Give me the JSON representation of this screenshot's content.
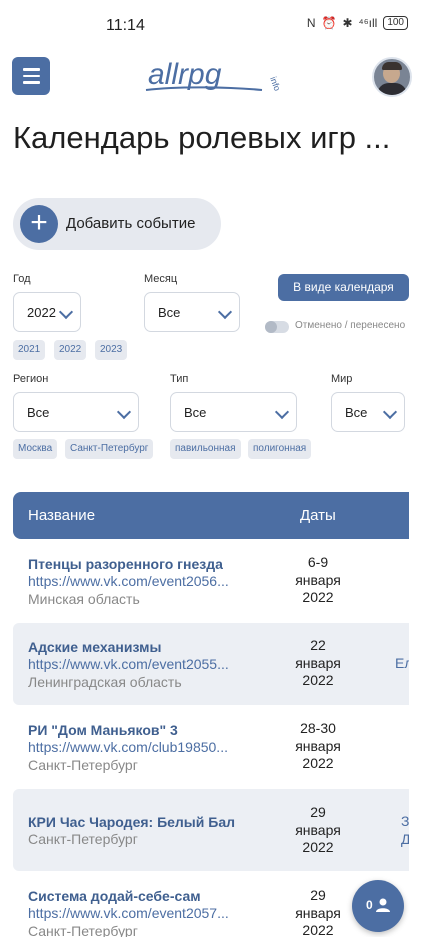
{
  "status": {
    "time": "11:14",
    "network": "N",
    "signal": "⁴⁶ıll",
    "battery": "100"
  },
  "header": {
    "logo_text": "allrpg",
    "logo_suffix": "info"
  },
  "page": {
    "title": "Календарь ролевых игр ..."
  },
  "add_event": {
    "label": "Добавить событие"
  },
  "filters": {
    "year": {
      "label": "Год",
      "value": "2022",
      "chips": [
        "2021",
        "2022",
        "2023"
      ]
    },
    "month": {
      "label": "Месяц",
      "value": "Все"
    },
    "calendar_button": "В виде календаря",
    "cancelled_toggle": "Отменено / перенесено",
    "region": {
      "label": "Регион",
      "value": "Все",
      "chips": [
        "Москва",
        "Санкт-Петербург"
      ]
    },
    "type": {
      "label": "Тип",
      "value": "Все",
      "chips": [
        "павильонная",
        "полигонная"
      ]
    },
    "world": {
      "label": "Мир",
      "value": "Все"
    }
  },
  "table": {
    "columns": [
      "Название",
      "Даты"
    ],
    "rows": [
      {
        "name": "Птенцы разоренного гнезда",
        "link": "https://www.vk.com/event2056...",
        "region": "Минская область",
        "date": [
          "6-9",
          "января",
          "2022"
        ],
        "extra": []
      },
      {
        "name": "Адские механизмы",
        "link": "https://www.vk.com/event2055...",
        "region": "Ленинградская область",
        "date": [
          "22",
          "января",
          "2022"
        ],
        "extra": [
          "",
          "Ел"
        ]
      },
      {
        "name": "РИ \"Дом Маньяков\" 3",
        "link": "https://www.vk.com/club19850...",
        "region": "Санкт-Петербург",
        "date": [
          "28-30",
          "января",
          "2022"
        ],
        "extra": []
      },
      {
        "name": "КРИ Час Чародея: Белый Бал",
        "link": "",
        "region": "Санкт-Петербург",
        "date": [
          "29",
          "января",
          "2022"
        ],
        "extra": [
          "З",
          "Д:"
        ]
      },
      {
        "name": "Система додай-себе-сам",
        "link": "https://www.vk.com/event2057...",
        "region": "Санкт-Петербург",
        "date": [
          "29",
          "января",
          "2022"
        ],
        "extra": []
      }
    ]
  },
  "fab": {
    "count": "0"
  }
}
